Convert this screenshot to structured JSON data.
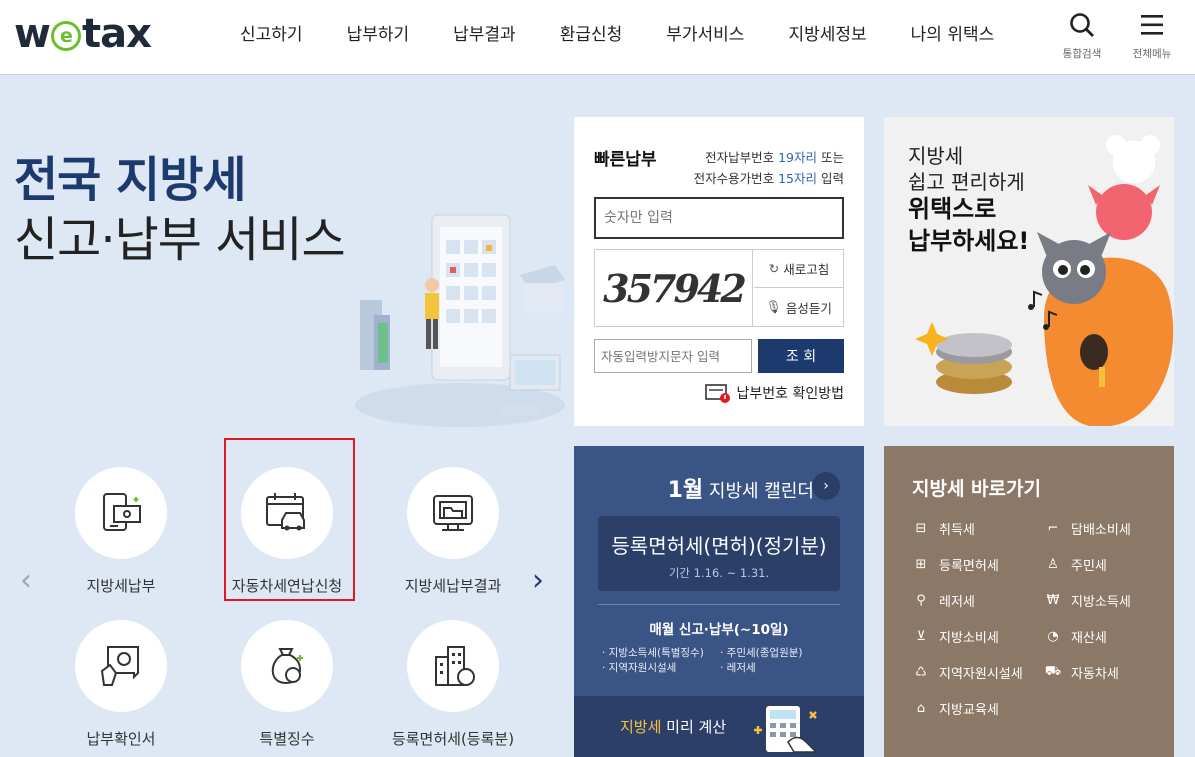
{
  "header": {
    "logo": {
      "pre": "w",
      "e": "e",
      "post": "tax"
    },
    "nav": [
      "신고하기",
      "납부하기",
      "납부결과",
      "환급신청",
      "부가서비스",
      "지방세정보",
      "나의 위택스"
    ],
    "search_label": "통합검색",
    "menu_label": "전체메뉴"
  },
  "hero": {
    "title_line1": "전국 지방세",
    "title_line2": "신고·납부 서비스"
  },
  "services": [
    {
      "label": "지방세납부",
      "icon": "tax-payment-icon"
    },
    {
      "label": "자동차세연납신청",
      "icon": "car-tax-annual-icon"
    },
    {
      "label": "지방세납부결과",
      "icon": "payment-result-icon"
    },
    {
      "label": "납부확인서",
      "icon": "payment-certificate-icon"
    },
    {
      "label": "특별징수",
      "icon": "special-collection-icon"
    },
    {
      "label": "등록면허세(등록분)",
      "icon": "registration-tax-icon"
    }
  ],
  "quick_pay": {
    "title": "빠른납부",
    "info_pre1": "전자납부번호 ",
    "info_hl1": "19자리",
    "info_post1": " 또는",
    "info_pre2": "전자수용가번호 ",
    "info_hl2": "15자리",
    "info_post2": " 입력",
    "input_placeholder": "숫자만 입력",
    "captcha_text": "357942",
    "refresh_label": "새로고침",
    "audio_label": "음성듣기",
    "auto_input_placeholder": "자동입력방지문자 입력",
    "search_button": "조 회",
    "help_link": "납부번호 확인방법"
  },
  "promo": {
    "line1": "지방세",
    "line2": "쉽고 편리하게",
    "line3": "위택스로",
    "line4": "납부하세요!"
  },
  "calendar": {
    "month": "1월",
    "title": " 지방세 캘린더",
    "event_title": "등록면허세(면허)(정기분)",
    "event_period": "기간 1.16. ~ 1.31.",
    "monthly_title": "매월 신고·납부(~10일)",
    "monthly_items": [
      "· 지방소득세(특별징수)",
      "· 주민세(종업원분)",
      "· 지역자원시설세",
      "· 레저세"
    ],
    "calc_highlight": "지방세",
    "calc_rest": " 미리 계산"
  },
  "shortcut": {
    "title": "지방세 바로가기",
    "items": [
      {
        "label": "취득세",
        "icon": "acquisition-tax-icon"
      },
      {
        "label": "담배소비세",
        "icon": "tobacco-tax-icon"
      },
      {
        "label": "등록면허세",
        "icon": "registration-license-tax-icon"
      },
      {
        "label": "주민세",
        "icon": "resident-tax-icon"
      },
      {
        "label": "레저세",
        "icon": "leisure-tax-icon"
      },
      {
        "label": "지방소득세",
        "icon": "local-income-tax-icon"
      },
      {
        "label": "지방소비세",
        "icon": "local-consumption-tax-icon"
      },
      {
        "label": "재산세",
        "icon": "property-tax-icon"
      },
      {
        "label": "지역자원시설세",
        "icon": "regional-resource-tax-icon"
      },
      {
        "label": "자동차세",
        "icon": "vehicle-tax-icon"
      },
      {
        "label": "지방교육세",
        "icon": "local-education-tax-icon"
      }
    ]
  },
  "colors": {
    "brand_navy": "#1d3a6e",
    "brand_green": "#6bbf2a",
    "calendar_bg": "#3b5486",
    "shortcut_bg": "#8c7866",
    "highlight_red": "#e0181f"
  }
}
